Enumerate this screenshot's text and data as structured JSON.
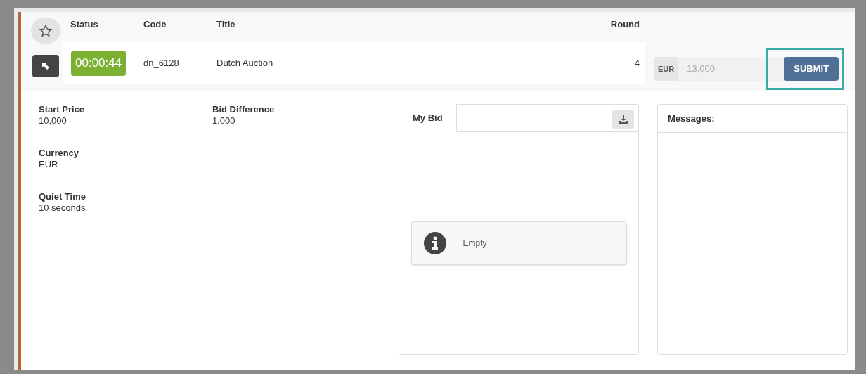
{
  "header": {
    "favorite": false,
    "columns": [
      "Status",
      "Code",
      "Title",
      "Round"
    ]
  },
  "auction": {
    "timer": "00:00:44",
    "code": "dn_6128",
    "title": "Dutch Auction",
    "round": "4"
  },
  "bid": {
    "currency": "EUR",
    "placeholder": "13,000",
    "submit": "SUBMIT",
    "highlighted": true
  },
  "details": [
    {
      "label": "Start Price",
      "value": "10,000"
    },
    {
      "label": "Bid Difference",
      "value": "1,000"
    },
    {
      "label": "Currency",
      "value": "EUR"
    },
    {
      "label": "Quiet Time",
      "value": "10 seconds"
    }
  ],
  "my_bid": {
    "tab": "My Bid",
    "empty": "Empty"
  },
  "messages": {
    "title": "Messages:"
  }
}
